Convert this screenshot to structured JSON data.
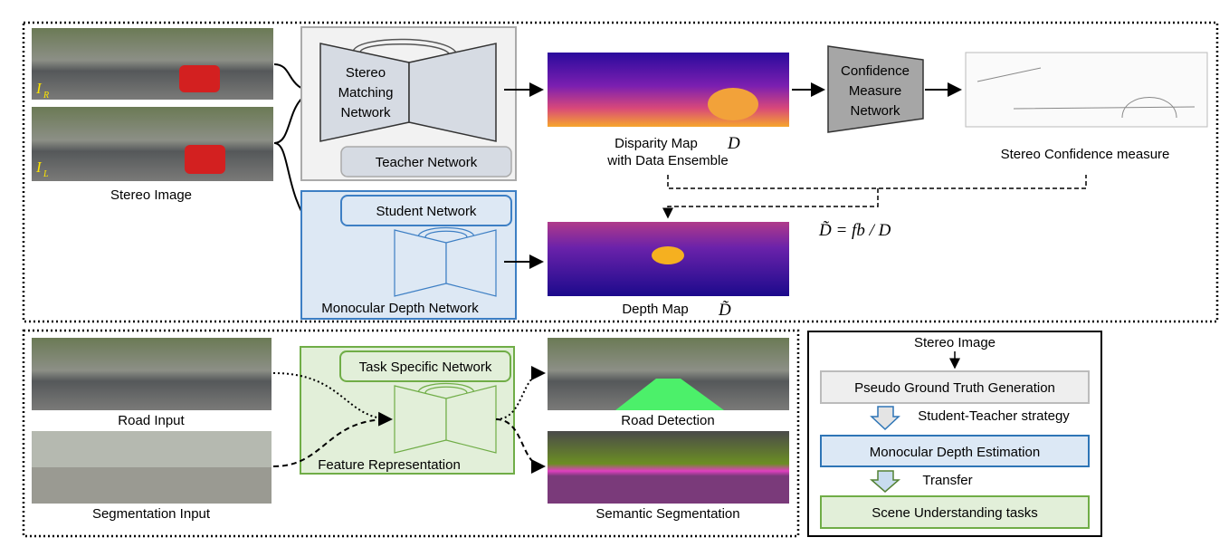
{
  "top": {
    "stereo_image_label": "Stereo Image",
    "right_image_tag": "I",
    "right_image_sub": "R",
    "left_image_tag": "I",
    "left_image_sub": "L",
    "teacher": {
      "line1": "Stereo",
      "line2": "Matching",
      "line3": "Network",
      "label": "Teacher Network"
    },
    "student": {
      "label": "Student Network",
      "caption": "Monocular Depth Network"
    },
    "disparity": {
      "line1": "Disparity Map",
      "symbol": "D",
      "line2": "with Data Ensemble"
    },
    "confidence_net": {
      "line1": "Confidence",
      "line2": "Measure",
      "line3": "Network"
    },
    "confidence_label": "Stereo Confidence measure",
    "formula": "D̃ = fb / D",
    "depth": {
      "label": "Depth Map",
      "symbol": "D̃"
    }
  },
  "bottom": {
    "road_input": "Road Input",
    "segmentation_input": "Segmentation Input",
    "task_label": "Task Specific Network",
    "feature_label": "Feature Representation",
    "road_detection": "Road Detection",
    "semantic_segmentation": "Semantic Segmentation"
  },
  "overview": {
    "input": "Stereo Image",
    "step1": "Pseudo Ground Truth Generation",
    "arrow1": "Student-Teacher strategy",
    "step2": "Monocular Depth Estimation",
    "arrow2": "Transfer",
    "step3": "Scene Understanding tasks"
  },
  "colors": {
    "teacher_fill": "#f2f2f2",
    "student_fill": "#dde8f4",
    "student_stroke": "#3d7fc4",
    "task_fill": "#e2efd9",
    "task_stroke": "#70ad47"
  }
}
